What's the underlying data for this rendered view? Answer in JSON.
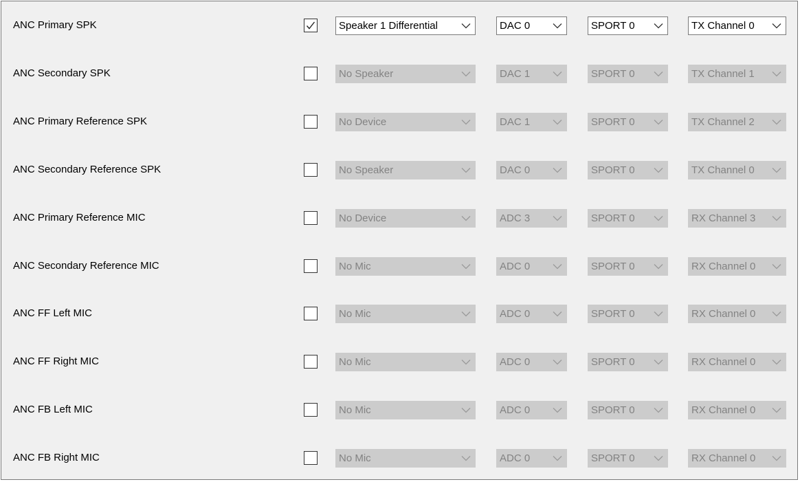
{
  "rows": [
    {
      "label": "ANC Primary SPK",
      "checked": true,
      "device": "Speaker 1 Differential",
      "converter": "DAC 0",
      "port": "SPORT 0",
      "channel": "TX Channel 0"
    },
    {
      "label": "ANC Secondary SPK",
      "checked": false,
      "device": "No Speaker",
      "converter": "DAC 1",
      "port": "SPORT 0",
      "channel": "TX Channel 1"
    },
    {
      "label": "ANC Primary Reference SPK",
      "checked": false,
      "device": "No Device",
      "converter": "DAC 1",
      "port": "SPORT 0",
      "channel": "TX Channel 2"
    },
    {
      "label": "ANC Secondary Reference SPK",
      "checked": false,
      "device": "No Speaker",
      "converter": "DAC 0",
      "port": "SPORT 0",
      "channel": "TX Channel 0"
    },
    {
      "label": "ANC Primary Reference MIC",
      "checked": false,
      "device": "No Device",
      "converter": "ADC 3",
      "port": "SPORT 0",
      "channel": "RX Channel 3"
    },
    {
      "label": "ANC Secondary Reference MIC",
      "checked": false,
      "device": "No Mic",
      "converter": "ADC 0",
      "port": "SPORT 0",
      "channel": "RX Channel 0"
    },
    {
      "label": "ANC FF Left MIC",
      "checked": false,
      "device": "No Mic",
      "converter": "ADC 0",
      "port": "SPORT 0",
      "channel": "RX Channel 0"
    },
    {
      "label": "ANC FF Right MIC",
      "checked": false,
      "device": "No Mic",
      "converter": "ADC 0",
      "port": "SPORT 0",
      "channel": "RX Channel 0"
    },
    {
      "label": "ANC FB Left MIC",
      "checked": false,
      "device": "No Mic",
      "converter": "ADC 0",
      "port": "SPORT 0",
      "channel": "RX Channel 0"
    },
    {
      "label": "ANC FB Right MIC",
      "checked": false,
      "device": "No Mic",
      "converter": "ADC 0",
      "port": "SPORT 0",
      "channel": "RX Channel 0"
    }
  ],
  "colors": {
    "panel_background": "#f0f0f0",
    "enabled_combo_background": "#ffffff",
    "disabled_combo_background": "#cccccc",
    "disabled_text": "#838383"
  },
  "icons": {
    "checkbox_mark": "check-mark-icon",
    "dropdown": "chevron-down-icon"
  }
}
